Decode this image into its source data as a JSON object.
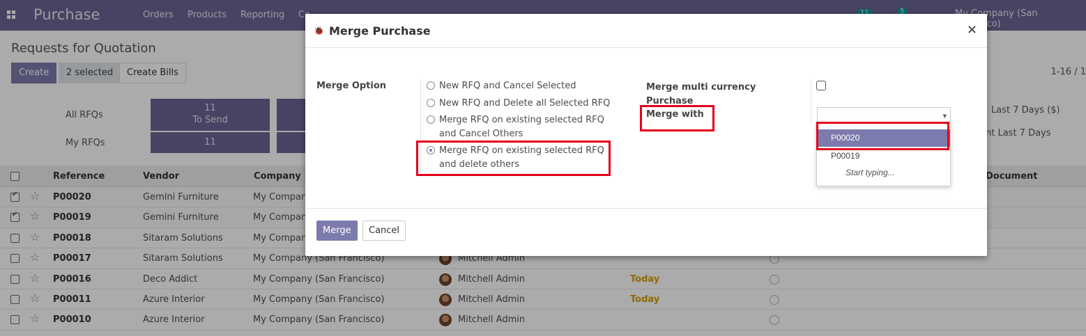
{
  "navbar": {
    "app_title": "Purchase",
    "menu": [
      "Orders",
      "Products",
      "Reporting",
      "Co"
    ],
    "badge1": "11",
    "badge2": "5",
    "company": "My Company (San Francisco)"
  },
  "control_panel": {
    "title": "Requests for Quotation",
    "create_label": "Create",
    "selected_label": "2 selected",
    "create_bills_label": "Create Bills",
    "pager": "1-16 / 1"
  },
  "dashboard": {
    "all_rfqs_label": "All RFQs",
    "my_rfqs_label": "My RFQs",
    "to_send_count": "11",
    "to_send_label": "To Send",
    "my_count": "11",
    "right_label_1": "Last 7 Days ($)",
    "right_label_2": "nt Last 7 Days"
  },
  "list": {
    "headers": {
      "reference": "Reference",
      "vendor": "Vendor",
      "company": "Company",
      "document": "Document"
    },
    "rows": [
      {
        "ref": "P00020",
        "vendor": "Gemini Furniture",
        "company": "My Compan",
        "user": "",
        "deadline": ""
      },
      {
        "ref": "P00019",
        "vendor": "Gemini Furniture",
        "company": "My Compan",
        "user": "",
        "deadline": ""
      },
      {
        "ref": "P00018",
        "vendor": "Sitaram Solutions",
        "company": "My Compan",
        "user": "",
        "deadline": ""
      },
      {
        "ref": "P00017",
        "vendor": "Sitaram Solutions",
        "company": "My Company (San Francisco)",
        "user": "Mitchell Admin",
        "deadline": ""
      },
      {
        "ref": "P00016",
        "vendor": "Deco Addict",
        "company": "My Company (San Francisco)",
        "user": "Mitchell Admin",
        "deadline": "Today"
      },
      {
        "ref": "P00011",
        "vendor": "Azure Interior",
        "company": "My Company (San Francisco)",
        "user": "Mitchell Admin",
        "deadline": "Today"
      },
      {
        "ref": "P00010",
        "vendor": "Azure Interior",
        "company": "My Company (San Francisco)",
        "user": "Mitchell Admin",
        "deadline": ""
      }
    ]
  },
  "modal": {
    "title": "Merge Purchase",
    "close": "×",
    "merge_option_label": "Merge Option",
    "options": [
      "New RFQ and Cancel Selected",
      "New RFQ and Delete all Selected RFQ",
      "Merge RFQ on existing selected RFQ and Cancel Others",
      "Merge RFQ on existing selected RFQ and delete others"
    ],
    "selected_option": 3,
    "multi_currency_label": "Merge multi currency Purchase",
    "merge_with_label": "Merge with",
    "dropdown": {
      "items": [
        "P00020",
        "P00019"
      ],
      "hint": "Start typing..."
    },
    "merge_button": "Merge",
    "cancel_button": "Cancel"
  },
  "colors": {
    "brand": "#6a6594",
    "primary": "#7c7bad",
    "highlight": "#e3001b",
    "today": "#d4a00a"
  }
}
